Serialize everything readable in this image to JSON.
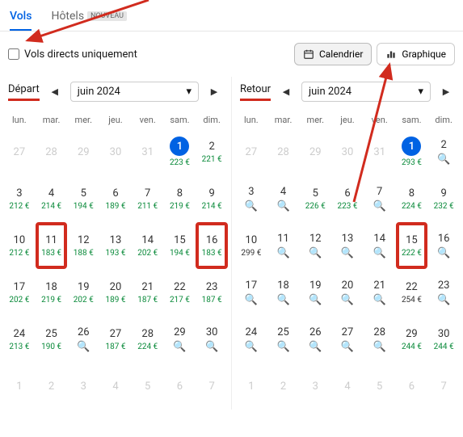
{
  "tabs": {
    "flights": "Vols",
    "hotels": "Hôtels",
    "hotelsBadge": "NOUVEAU"
  },
  "directOnly": "Vols directs uniquement",
  "view": {
    "calendar": "Calendrier",
    "chart": "Graphique"
  },
  "depart": {
    "label": "Départ",
    "month": "juin 2024"
  },
  "return": {
    "label": "Retour",
    "month": "juin 2024"
  },
  "wdays": [
    "lun.",
    "mar.",
    "mer.",
    "jeu.",
    "ven.",
    "sam.",
    "dim."
  ],
  "dep": [
    {
      "d": 27,
      "dim": 1
    },
    {
      "d": 28,
      "dim": 1
    },
    {
      "d": 29,
      "dim": 1
    },
    {
      "d": 30,
      "dim": 1
    },
    {
      "d": 31,
      "dim": 1
    },
    {
      "d": 1,
      "sel": 1,
      "p": "223 €"
    },
    {
      "d": 2,
      "p": "221 €"
    },
    {
      "d": 3,
      "p": "212 €"
    },
    {
      "d": 4,
      "p": "214 €"
    },
    {
      "d": 5,
      "p": "194 €"
    },
    {
      "d": 6,
      "p": "189 €"
    },
    {
      "d": 7,
      "p": "211 €"
    },
    {
      "d": 8,
      "p": "219 €"
    },
    {
      "d": 9,
      "p": "214 €"
    },
    {
      "d": 10,
      "p": "212 €"
    },
    {
      "d": 11,
      "p": "183 €",
      "hl": 1
    },
    {
      "d": 12,
      "p": "188 €"
    },
    {
      "d": 13,
      "p": "193 €"
    },
    {
      "d": 14,
      "p": "202 €"
    },
    {
      "d": 15,
      "p": "194 €"
    },
    {
      "d": 16,
      "p": "183 €",
      "hl": 1
    },
    {
      "d": 17,
      "p": "202 €"
    },
    {
      "d": 18,
      "p": "219 €"
    },
    {
      "d": 19,
      "p": "202 €"
    },
    {
      "d": 20,
      "p": "189 €"
    },
    {
      "d": 21,
      "p": "187 €"
    },
    {
      "d": 22,
      "p": "217 €"
    },
    {
      "d": 23,
      "p": "187 €"
    },
    {
      "d": 24,
      "p": "213 €"
    },
    {
      "d": 25,
      "p": "190 €"
    },
    {
      "d": 26,
      "s": 1
    },
    {
      "d": 27,
      "p": "187 €"
    },
    {
      "d": 28,
      "p": "224 €"
    },
    {
      "d": 29,
      "s": 1
    },
    {
      "d": 30,
      "s": 1
    },
    {
      "d": 1,
      "dim": 1
    },
    {
      "d": 2,
      "dim": 1
    },
    {
      "d": 3,
      "dim": 1
    },
    {
      "d": 4,
      "dim": 1
    },
    {
      "d": 5,
      "dim": 1
    },
    {
      "d": 6,
      "dim": 1
    },
    {
      "d": 7,
      "dim": 1
    }
  ],
  "ret": [
    {
      "d": 27,
      "dim": 1
    },
    {
      "d": 28,
      "dim": 1
    },
    {
      "d": 29,
      "dim": 1
    },
    {
      "d": 30,
      "dim": 1
    },
    {
      "d": 31,
      "dim": 1
    },
    {
      "d": 1,
      "sel": 1,
      "p": "293 €"
    },
    {
      "d": 2,
      "s": 1
    },
    {
      "d": 3,
      "s": 1
    },
    {
      "d": 4,
      "s": 1
    },
    {
      "d": 5,
      "p": "226 €"
    },
    {
      "d": 6,
      "p": "223 €"
    },
    {
      "d": 7,
      "s": 1
    },
    {
      "d": 8,
      "p": "224 €"
    },
    {
      "d": 9,
      "p": "232 €"
    },
    {
      "d": 10,
      "p": "299 €",
      "dk": 1
    },
    {
      "d": 11,
      "s": 1
    },
    {
      "d": 12,
      "s": 1
    },
    {
      "d": 13,
      "s": 1
    },
    {
      "d": 14,
      "s": 1
    },
    {
      "d": 15,
      "p": "222 €",
      "hl": 1
    },
    {
      "d": 16,
      "s": 1
    },
    {
      "d": 17,
      "s": 1
    },
    {
      "d": 18,
      "s": 1
    },
    {
      "d": 19,
      "s": 1
    },
    {
      "d": 20,
      "s": 1
    },
    {
      "d": 21,
      "s": 1
    },
    {
      "d": 22,
      "p": "254 €",
      "dk": 1
    },
    {
      "d": 23,
      "s": 1
    },
    {
      "d": 24,
      "s": 1
    },
    {
      "d": 25,
      "s": 1
    },
    {
      "d": 26,
      "s": 1
    },
    {
      "d": 27,
      "s": 1
    },
    {
      "d": 28,
      "s": 1
    },
    {
      "d": 29,
      "p": "244 €"
    },
    {
      "d": 30,
      "p": "244 €"
    },
    {
      "d": 1,
      "dim": 1
    },
    {
      "d": 2,
      "dim": 1
    },
    {
      "d": 3,
      "dim": 1
    },
    {
      "d": 4,
      "dim": 1
    },
    {
      "d": 5,
      "dim": 1
    },
    {
      "d": 6,
      "dim": 1
    },
    {
      "d": 7,
      "dim": 1
    }
  ]
}
